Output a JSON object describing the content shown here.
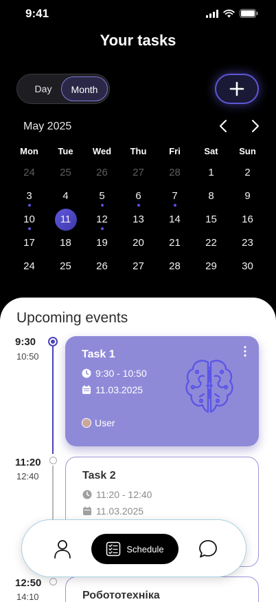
{
  "status_bar": {
    "time": "9:41",
    "icons": [
      "signal-icon",
      "wifi-icon",
      "battery-icon"
    ]
  },
  "header": {
    "title": "Your tasks"
  },
  "view_toggle": {
    "options": [
      "Day",
      "Month"
    ],
    "selected": "Month"
  },
  "add_button": {
    "icon": "plus-icon"
  },
  "calendar": {
    "month_label": "May 2025",
    "weekdays": [
      "Mon",
      "Tue",
      "Wed",
      "Thu",
      "Fri",
      "Sat",
      "Sun"
    ],
    "weeks": [
      [
        "24",
        "25",
        "26",
        "27",
        "28",
        "1",
        "2"
      ],
      [
        "3",
        "4",
        "5",
        "6",
        "7",
        "8",
        "9"
      ],
      [
        "10",
        "11",
        "12",
        "13",
        "14",
        "15",
        "16"
      ],
      [
        "17",
        "18",
        "19",
        "20",
        "21",
        "22",
        "23"
      ],
      [
        "24",
        "25",
        "26",
        "27",
        "28",
        "29",
        "30"
      ]
    ],
    "muted_days": [
      "24",
      "25",
      "26",
      "27",
      "28"
    ],
    "event_dot_days": [
      "3",
      "5",
      "6",
      "7",
      "10",
      "12"
    ],
    "selected_day": "11"
  },
  "events_section": {
    "title": "Upcoming events",
    "events": [
      {
        "start": "9:30",
        "end": "10:50",
        "title": "Task 1",
        "time_range": "9:30 - 10:50",
        "date": "11.03.2025",
        "user": "User"
      },
      {
        "start": "11:20",
        "end": "12:40",
        "title": "Task 2",
        "time_range": "11:20 - 12:40",
        "date": "11.03.2025"
      },
      {
        "start": "12:50",
        "end": "14:10",
        "title": "Робототехніка"
      }
    ]
  },
  "bottom_nav": {
    "schedule_label": "Schedule"
  },
  "colors": {
    "accent": "#5a53e0",
    "card_bg": "#8f8ad8",
    "background": "#000000",
    "sheet": "#ffffff"
  }
}
